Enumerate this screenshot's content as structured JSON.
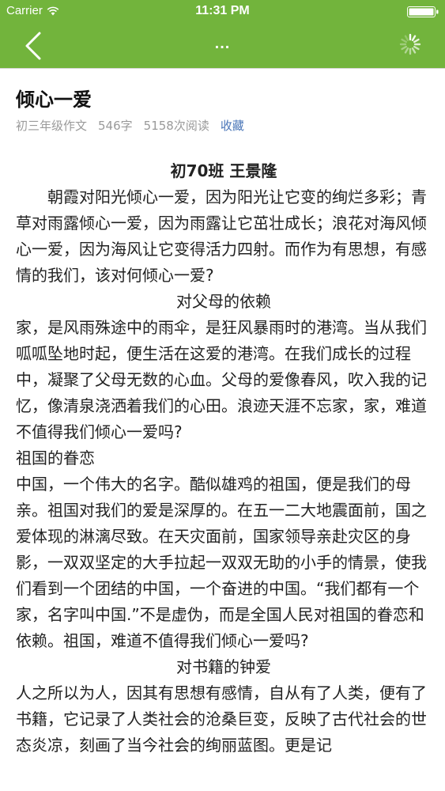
{
  "status_bar": {
    "carrier": "Carrier",
    "time": "11:31 PM"
  },
  "nav": {
    "more_label": "...",
    "back_icon": "chevron-left-icon",
    "loading_icon": "spinner-icon",
    "color": "#72b43c"
  },
  "article": {
    "title": "倾心一爱",
    "meta": {
      "category": "初三年级作文",
      "word_count": "546字",
      "read_count": "5158次阅读",
      "favorite": "收藏"
    },
    "author": "初70班 王景隆",
    "intro": "朝霞对阳光倾心一爱，因为阳光让它变的绚烂多彩；青草对雨露倾心一爱，因为雨露让它茁壮成长；浪花对海风倾心一爱，因为海风让它变得活力四射。而作为有思想，有感情的我们，该对何倾心一爱?",
    "section1_heading": "对父母的依赖",
    "section1_text": "家，是风雨殊途中的雨伞，是狂风暴雨时的港湾。当从我们呱呱坠地时起，便生活在这爱的港湾。在我们成长的过程中，凝聚了父母无数的心血。父母的爱像春风，吹入我的记忆，像清泉浇洒着我们的心田。浪迹天涯不忘家，家，难道不值得我们倾心一爱吗?",
    "section2_heading": "祖国的眷恋",
    "section2_text": "中国，一个伟大的名字。酷似雄鸡的祖国，便是我们的母亲。祖国对我们的爱是深厚的。在五一二大地震面前，国之爱体现的淋漓尽致。在天灾面前，国家领导亲赴灾区的身影，一双双坚定的大手拉起一双双无助的小手的情景，使我们看到一个团结的中国，一个奋进的中国。“我们都有一个家，名字叫中国.”不是虚伪，而是全国人民对祖国的眷恋和依赖。祖国，难道不值得我们倾心一爱吗?",
    "section3_heading": "对书籍的钟爱",
    "section3_text": "人之所以为人，因其有思想有感情，自从有了人类，便有了书籍，它记录了人类社会的沧桑巨变，反映了古代社会的世态炎凉，刻画了当今社会的绚丽蓝图。更是记"
  }
}
